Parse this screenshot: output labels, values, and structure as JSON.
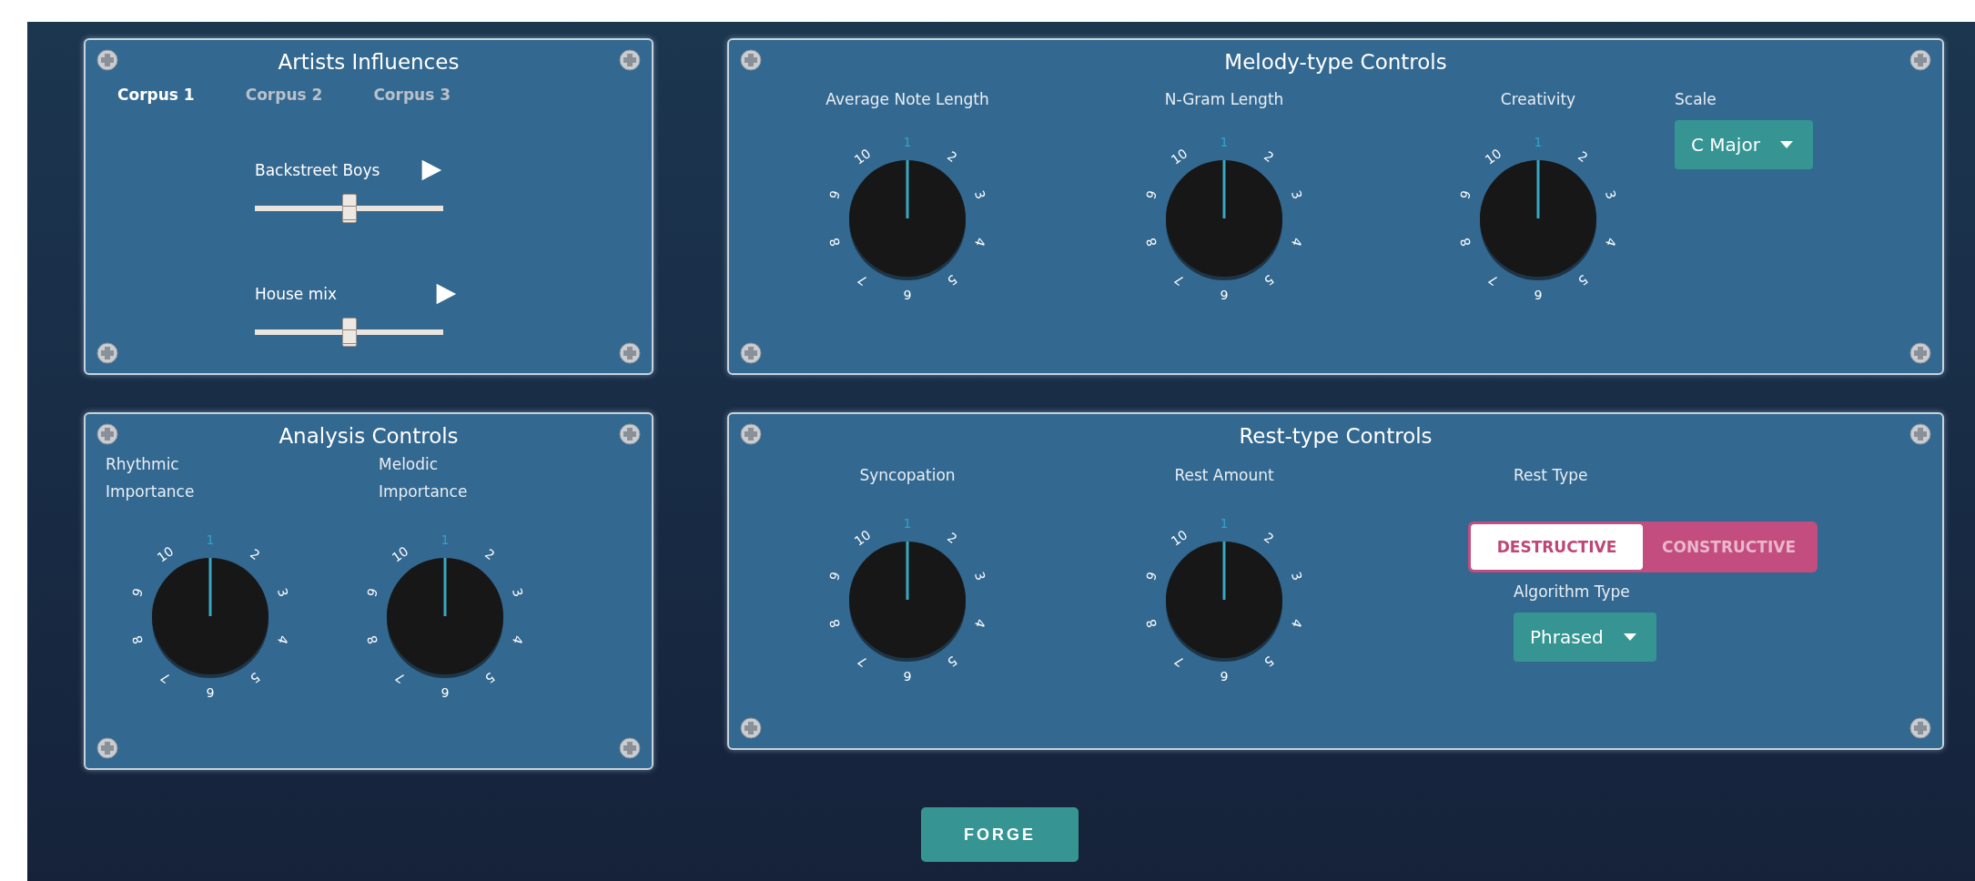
{
  "artists_influences": {
    "title": "Artists Influences",
    "tabs": [
      {
        "label": "Corpus 1",
        "selected": true
      },
      {
        "label": "Corpus 2",
        "selected": false
      },
      {
        "label": "Corpus 3",
        "selected": false
      }
    ],
    "tracks": [
      {
        "name": "Backstreet Boys",
        "level": 0.5
      },
      {
        "name": "House mix",
        "level": 0.5
      }
    ]
  },
  "melody_controls": {
    "title": "Melody-type Controls",
    "knobs": [
      {
        "label": "Average Note Length",
        "dial_numbers": [
          "1",
          "2",
          "3",
          "4",
          "5",
          "6",
          "7",
          "8",
          "9",
          "10"
        ]
      },
      {
        "label": "N-Gram Length",
        "dial_numbers": [
          "1",
          "2",
          "3",
          "4",
          "5",
          "6",
          "7",
          "8",
          "9",
          "10"
        ]
      },
      {
        "label": "Creativity",
        "dial_numbers": [
          "1",
          "2",
          "3",
          "4",
          "5",
          "6",
          "7",
          "8",
          "9",
          "10"
        ]
      }
    ],
    "scale_select": {
      "label": "Scale",
      "value": "C Major"
    }
  },
  "analysis_controls": {
    "title": "Analysis Controls",
    "knobs": [
      {
        "label": "Rhythmic Importance",
        "dial_numbers": [
          "1",
          "2",
          "3",
          "4",
          "5",
          "6",
          "7",
          "8",
          "9",
          "10"
        ]
      },
      {
        "label": "Melodic Importance",
        "dial_numbers": [
          "1",
          "2",
          "3",
          "4",
          "5",
          "6",
          "7",
          "8",
          "9",
          "10"
        ]
      }
    ]
  },
  "rest_controls": {
    "title": "Rest-type Controls",
    "knobs": [
      {
        "label": "Syncopation",
        "dial_numbers": [
          "1",
          "2",
          "3",
          "4",
          "5",
          "6",
          "7",
          "8",
          "9",
          "10"
        ]
      },
      {
        "label": "Rest Amount",
        "dial_numbers": [
          "1",
          "2",
          "3",
          "4",
          "5",
          "6",
          "7",
          "8",
          "9",
          "10"
        ]
      }
    ],
    "rest_type": {
      "label": "Rest Type",
      "options": [
        {
          "label": "DESTRUCTIVE",
          "selected": true
        },
        {
          "label": "CONSTRUCTIVE",
          "selected": false
        }
      ]
    },
    "algorithm_type": {
      "label": "Algorithm Type",
      "value": "Phrased"
    }
  },
  "forge_button": "FORGE"
}
